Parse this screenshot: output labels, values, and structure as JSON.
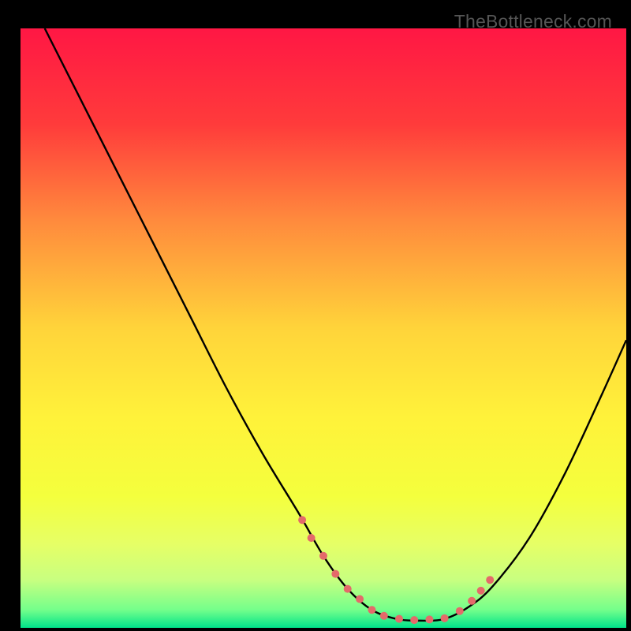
{
  "watermark": "TheBottleneck.com",
  "chart_data": {
    "type": "line",
    "title": "",
    "xlabel": "",
    "ylabel": "",
    "xlim": [
      0,
      100
    ],
    "ylim": [
      0,
      100
    ],
    "background_gradient": {
      "stops": [
        {
          "pos": 0.0,
          "color": "#ff1744"
        },
        {
          "pos": 0.16,
          "color": "#ff3b3b"
        },
        {
          "pos": 0.32,
          "color": "#ff8a3d"
        },
        {
          "pos": 0.5,
          "color": "#ffd43a"
        },
        {
          "pos": 0.65,
          "color": "#fff23a"
        },
        {
          "pos": 0.78,
          "color": "#f4ff3d"
        },
        {
          "pos": 0.86,
          "color": "#e6ff66"
        },
        {
          "pos": 0.92,
          "color": "#c8ff80"
        },
        {
          "pos": 0.97,
          "color": "#74ff8b"
        },
        {
          "pos": 1.0,
          "color": "#00e38a"
        }
      ]
    },
    "series": [
      {
        "name": "curve",
        "color": "#000000",
        "x": [
          4,
          10,
          16,
          22,
          28,
          34,
          40,
          46,
          50,
          54,
          58,
          62,
          66,
          70,
          74,
          78,
          84,
          90,
          96,
          100
        ],
        "y": [
          100,
          88,
          76,
          64,
          52,
          40,
          29,
          19,
          12,
          6.5,
          3,
          1.5,
          1.2,
          1.5,
          3.5,
          7,
          15,
          26,
          39,
          48
        ]
      }
    ],
    "markers": {
      "name": "highlight-dots",
      "color": "#e46a6a",
      "radius": 5,
      "x": [
        46.5,
        48,
        50,
        52,
        54,
        56,
        58,
        60,
        62.5,
        65,
        67.5,
        70,
        72.5,
        74.5,
        76,
        77.5
      ],
      "y": [
        18,
        15,
        12,
        9,
        6.5,
        4.8,
        3,
        2.0,
        1.5,
        1.3,
        1.4,
        1.6,
        2.8,
        4.5,
        6.2,
        8.0
      ]
    }
  }
}
